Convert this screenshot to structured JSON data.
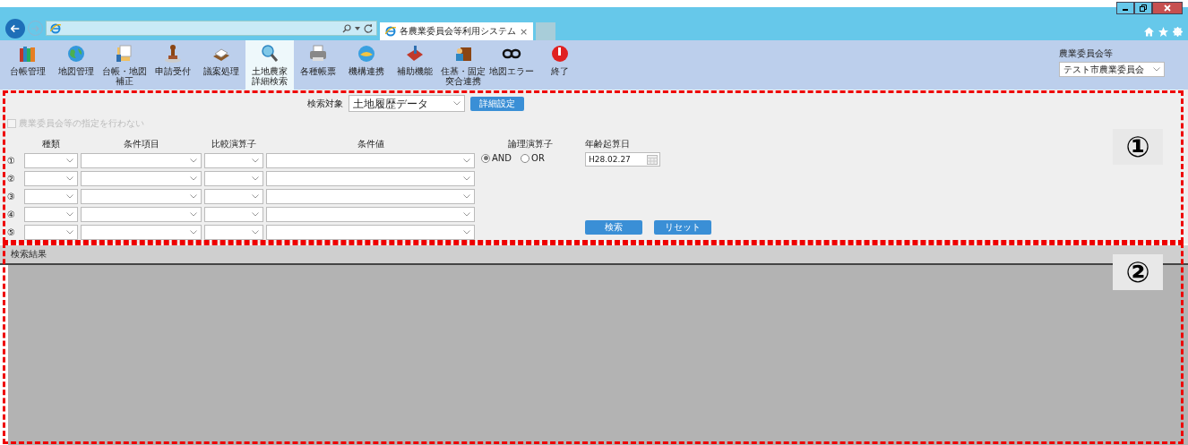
{
  "browser": {
    "tab_title": "各農業委員会等利用システム",
    "tab_close": "×"
  },
  "toolbar": [
    {
      "lines": [
        "台帳管理"
      ],
      "selected": false
    },
    {
      "lines": [
        "地図管理"
      ],
      "selected": false
    },
    {
      "lines": [
        "台帳・地図",
        "補正"
      ],
      "selected": false
    },
    {
      "lines": [
        "申請受付"
      ],
      "selected": false
    },
    {
      "lines": [
        "議案処理"
      ],
      "selected": false
    },
    {
      "lines": [
        "土地農家",
        "詳細検索"
      ],
      "selected": true
    },
    {
      "lines": [
        "各種帳票"
      ],
      "selected": false
    },
    {
      "lines": [
        "機構連携"
      ],
      "selected": false
    },
    {
      "lines": [
        "補助機能"
      ],
      "selected": false
    },
    {
      "lines": [
        "住基・固定",
        "突合連携"
      ],
      "selected": false
    },
    {
      "lines": [
        "地図エラー"
      ],
      "selected": false
    },
    {
      "lines": [
        "終了"
      ],
      "selected": false
    }
  ],
  "committee": {
    "label": "農業委員会等",
    "value": "テスト市農業委員会"
  },
  "search": {
    "target_label": "検索対象",
    "target_value": "土地履歴データ",
    "detail_button": "詳細設定",
    "no_committee_checkbox": {
      "label": "農業委員会等の指定を行わない",
      "checked": false,
      "disabled": true
    },
    "columns": [
      "種類",
      "条件項目",
      "比較演算子",
      "条件値"
    ],
    "rows": [
      {
        "marker": "①"
      },
      {
        "marker": "②"
      },
      {
        "marker": "③"
      },
      {
        "marker": "④"
      },
      {
        "marker": "⑤"
      }
    ],
    "logic_label": "論理演算子",
    "logic_options": [
      {
        "label": "AND",
        "selected": true
      },
      {
        "label": "OR",
        "selected": false
      }
    ],
    "date_label": "年齢起算日",
    "date_value": "H28.02.27",
    "buttons": [
      "検索",
      "リセット"
    ]
  },
  "results": {
    "title": "検索結果"
  },
  "annotations": [
    {
      "label": "①"
    },
    {
      "label": "②"
    }
  ]
}
